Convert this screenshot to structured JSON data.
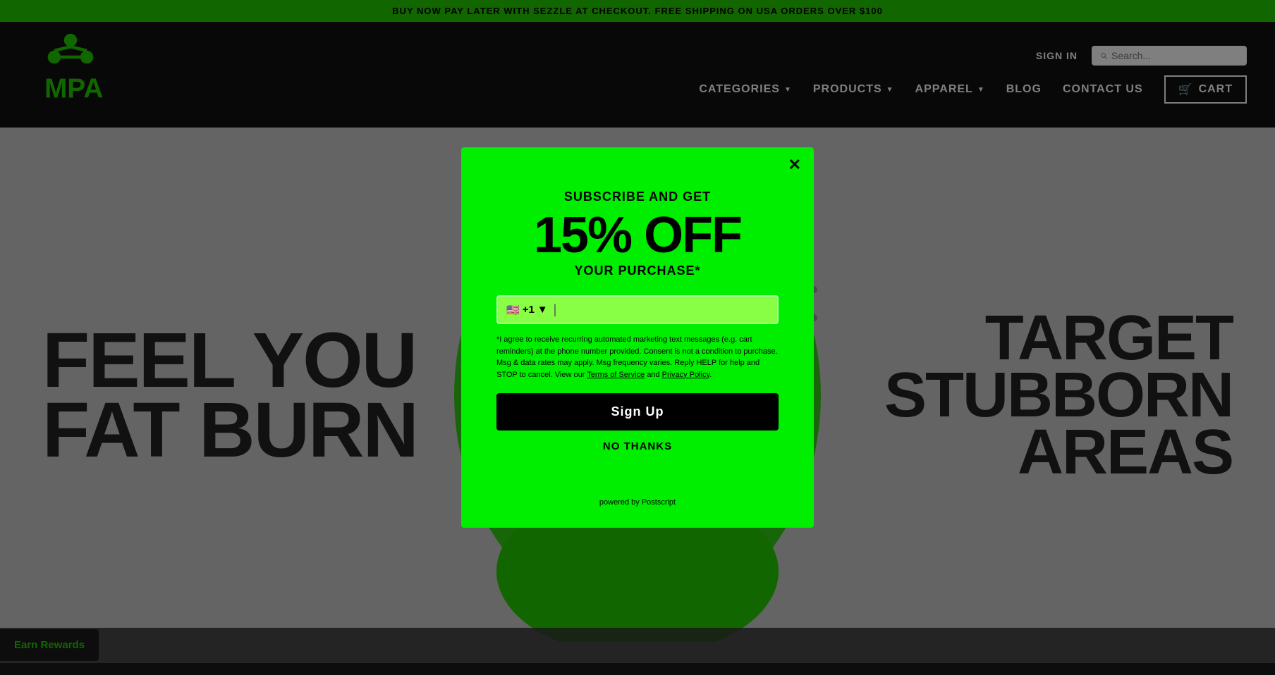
{
  "top_banner": {
    "text": "BUY NOW PAY LATER WITH SEZZLE AT CHECKOUT. FREE SHIPPING ON USA ORDERS OVER $100"
  },
  "header": {
    "sign_in_label": "SIGN IN",
    "search_placeholder": "Search...",
    "nav_items": [
      {
        "label": "CATEGORIES",
        "has_dropdown": true
      },
      {
        "label": "PRODUCTS",
        "has_dropdown": true
      },
      {
        "label": "APPAREL",
        "has_dropdown": true
      },
      {
        "label": "BLOG",
        "has_dropdown": false
      },
      {
        "label": "CONTACT US",
        "has_dropdown": false
      }
    ],
    "cart_label": "CART"
  },
  "hero": {
    "left_text_line1": "FEEL YOU",
    "left_text_line2": "FAT BURN",
    "right_text_line1": "TARGET",
    "right_text_line2": "STUBBORN",
    "right_text_line3": "AREAS"
  },
  "modal": {
    "subscribe_label": "SUBSCRIBE AND GET",
    "discount_label": "15% OFF",
    "purchase_label": "YOUR PURCHASE*",
    "phone_code": "+1",
    "phone_placeholder": "",
    "consent_text": "*I agree to receive recurring automated marketing text messages (e.g. cart reminders) at the phone number provided. Consent is not a condition to purchase. Msg & data rates may apply. Msg frequency varies. Reply HELP for help and STOP to cancel. View our ",
    "terms_label": "Terms of Service",
    "and_label": "and",
    "privacy_label": "Privacy Policy",
    "consent_end": ".",
    "signup_label": "Sign Up",
    "no_thanks_label": "NO THANKS",
    "powered_by_label": "powered by Postscript"
  },
  "earn_rewards": {
    "label": "Earn Rewards"
  }
}
